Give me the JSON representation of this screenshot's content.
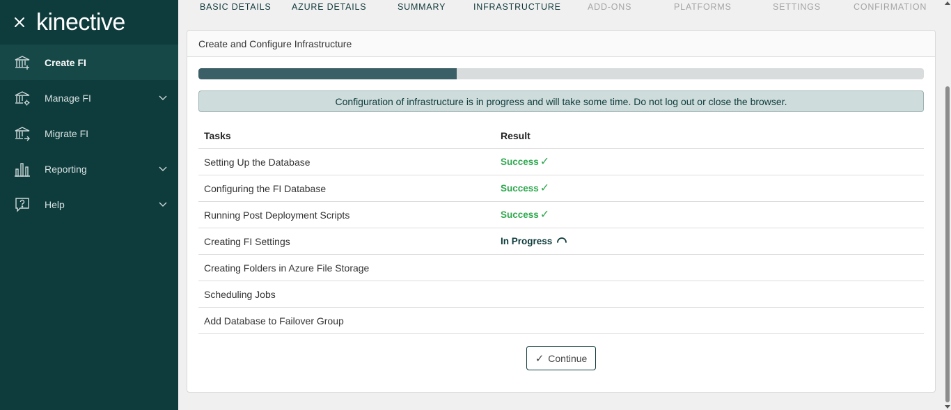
{
  "brand": {
    "logo_text": "kinective",
    "close_icon": "close-icon"
  },
  "sidebar": {
    "items": [
      {
        "label": "Create FI",
        "icon": "bank-add-icon",
        "active": true,
        "expandable": false
      },
      {
        "label": "Manage FI",
        "icon": "bank-gear-icon",
        "active": false,
        "expandable": true
      },
      {
        "label": "Migrate FI",
        "icon": "bank-arrow-icon",
        "active": false,
        "expandable": false
      },
      {
        "label": "Reporting",
        "icon": "bar-chart-icon",
        "active": false,
        "expandable": true
      },
      {
        "label": "Help",
        "icon": "help-icon",
        "active": false,
        "expandable": true
      }
    ]
  },
  "steps": [
    {
      "label": "BASIC DETAILS",
      "enabled": true
    },
    {
      "label": "AZURE DETAILS",
      "enabled": true
    },
    {
      "label": "SUMMARY",
      "enabled": true
    },
    {
      "label": "INFRASTRUCTURE",
      "enabled": true
    },
    {
      "label": "ADD-ONS",
      "enabled": false
    },
    {
      "label": "PLATFORMS",
      "enabled": false
    },
    {
      "label": "SETTINGS",
      "enabled": false
    },
    {
      "label": "CONFIRMATION",
      "enabled": false
    }
  ],
  "card": {
    "title": "Create and Configure Infrastructure",
    "progress_fraction": 0.356,
    "alert": "Configuration of infrastructure is in progress and will take some time. Do not log out or close the browser.",
    "table": {
      "headers": {
        "task": "Tasks",
        "result": "Result"
      },
      "rows": [
        {
          "task": "Setting Up the Database",
          "result": "Success",
          "status": "success"
        },
        {
          "task": "Configuring the FI Database",
          "result": "Success",
          "status": "success"
        },
        {
          "task": "Running Post Deployment Scripts",
          "result": "Success",
          "status": "success"
        },
        {
          "task": "Creating FI Settings",
          "result": "In Progress",
          "status": "progress"
        },
        {
          "task": "Creating Folders in Azure File Storage",
          "result": "",
          "status": "pending"
        },
        {
          "task": "Scheduling Jobs",
          "result": "",
          "status": "pending"
        },
        {
          "task": "Add Database to Failover Group",
          "result": "",
          "status": "pending"
        }
      ]
    },
    "continue_label": "Continue"
  },
  "colors": {
    "sidebar_bg": "#0e3b3b",
    "success": "#2fa84f",
    "progress_fill": "#3b5f66"
  }
}
